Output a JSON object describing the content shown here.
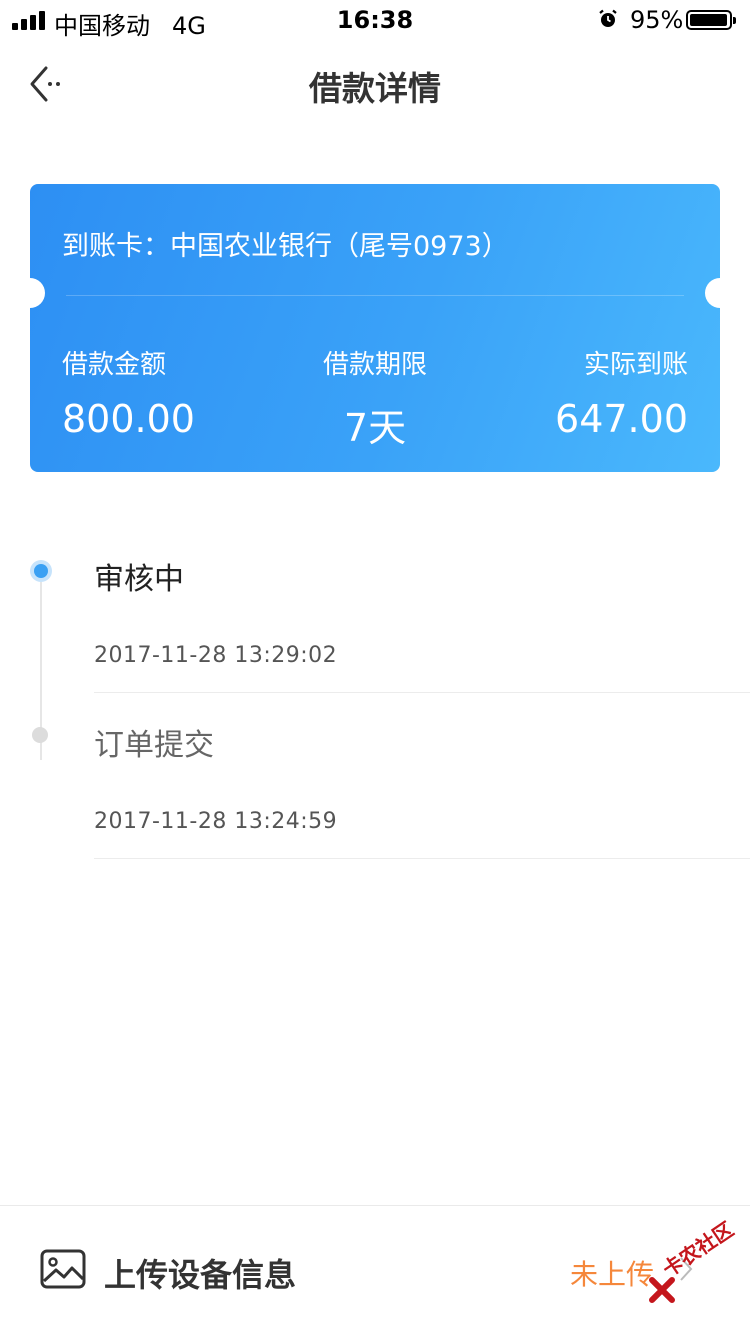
{
  "status_bar": {
    "carrier": "中国移动",
    "network": "4G",
    "time": "16:38",
    "battery_percent": "95%",
    "battery_level": 0.95,
    "signal_bars": 4
  },
  "nav": {
    "back_icon": "chevron-left-icon",
    "title": "借款详情"
  },
  "card": {
    "account": "到账卡：中国农业银行（尾号0973）",
    "colors": {
      "gradient_start": "#2d8ff3",
      "gradient_end": "#4ab8fc"
    },
    "stats": [
      {
        "label": "借款金额",
        "value": "800.00"
      },
      {
        "label": "借款期限",
        "value": "7天"
      },
      {
        "label": "实际到账",
        "value": "647.00"
      }
    ]
  },
  "timeline": [
    {
      "title": "审核中",
      "time": "2017-11-28 13:29:02",
      "active": true
    },
    {
      "title": "订单提交",
      "time": "2017-11-28 13:24:59",
      "active": false
    }
  ],
  "timeline_colors": {
    "active_dot": "#3aa0f3",
    "active_title": "#222222",
    "inactive_title": "#666666"
  },
  "upload": {
    "icon": "image-icon",
    "label": "上传设备信息",
    "status": "未上传",
    "status_color": "#f5873b",
    "chevron_icon": "chevron-right-icon"
  },
  "watermark": {
    "text": "卡农社区",
    "color": "#c4161c"
  }
}
